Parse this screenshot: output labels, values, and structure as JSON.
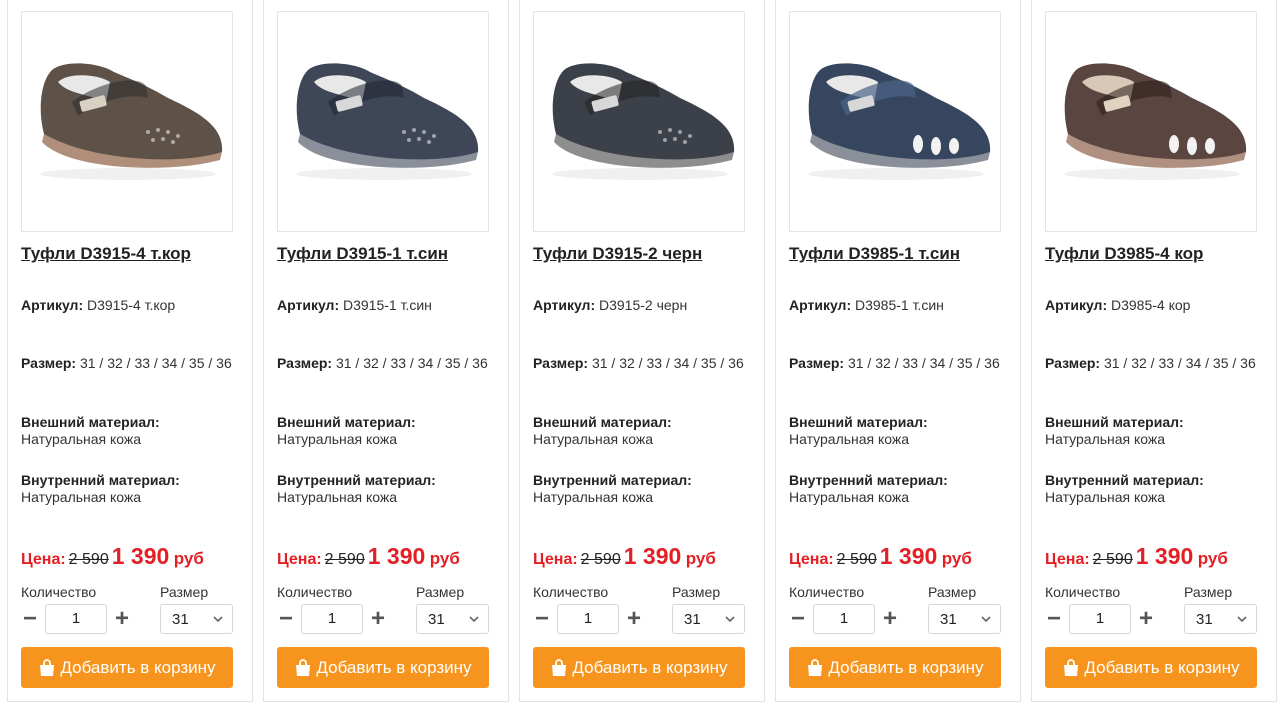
{
  "labels": {
    "article": "Артикул:",
    "size": "Размер:",
    "outer": "Внешний материал:",
    "inner": "Внутренний материал:",
    "price": "Цена:",
    "quantity": "Количество",
    "size_select": "Размер",
    "add_to_cart": "Добавить в корзину",
    "minus": "−",
    "plus": "+"
  },
  "colors": {
    "accent_orange": "#f7941d",
    "price_red": "#e31e24"
  },
  "icons": {
    "cart": "shopping-bag-icon",
    "dropdown": "chevron-down-icon"
  },
  "products": [
    {
      "title": "Туфли D3915-4 т.кор",
      "article": "D3915-4 т.кор",
      "sizes": "31 / 32 / 33 / 34 / 35 / 36",
      "outer_material": "Натуральная кожа",
      "inner_material": "Натуральная кожа",
      "old_price": "2 590",
      "new_price": "1 390",
      "currency": "руб",
      "quantity": "1",
      "selected_size": "31",
      "shoe_color": "#5e5148"
    },
    {
      "title": "Туфли D3915-1 т.син",
      "article": "D3915-1 т.син",
      "sizes": "31 / 32 / 33 / 34 / 35 / 36",
      "outer_material": "Натуральная кожа",
      "inner_material": "Натуральная кожа",
      "old_price": "2 590",
      "new_price": "1 390",
      "currency": "руб",
      "quantity": "1",
      "selected_size": "31",
      "shoe_color": "#3e4658"
    },
    {
      "title": "Туфли D3915-2 черн",
      "article": "D3915-2 черн",
      "sizes": "31 / 32 / 33 / 34 / 35 / 36",
      "outer_material": "Натуральная кожа",
      "inner_material": "Натуральная кожа",
      "old_price": "2 590",
      "new_price": "1 390",
      "currency": "руб",
      "quantity": "1",
      "selected_size": "31",
      "shoe_color": "#3c4048"
    },
    {
      "title": "Туфли D3985-1 т.син",
      "article": "D3985-1 т.син",
      "sizes": "31 / 32 / 33 / 34 / 35 / 36",
      "outer_material": "Натуральная кожа",
      "inner_material": "Натуральная кожа",
      "old_price": "2 590",
      "new_price": "1 390",
      "currency": "руб",
      "quantity": "1",
      "selected_size": "31",
      "shoe_color": "#37465f"
    },
    {
      "title": "Туфли D3985-4 кор",
      "article": "D3985-4 кор",
      "sizes": "31 / 32 / 33 / 34 / 35 / 36",
      "outer_material": "Натуральная кожа",
      "inner_material": "Натуральная кожа",
      "old_price": "2 590",
      "new_price": "1 390",
      "currency": "руб",
      "quantity": "1",
      "selected_size": "31",
      "shoe_color": "#5a4540"
    }
  ]
}
